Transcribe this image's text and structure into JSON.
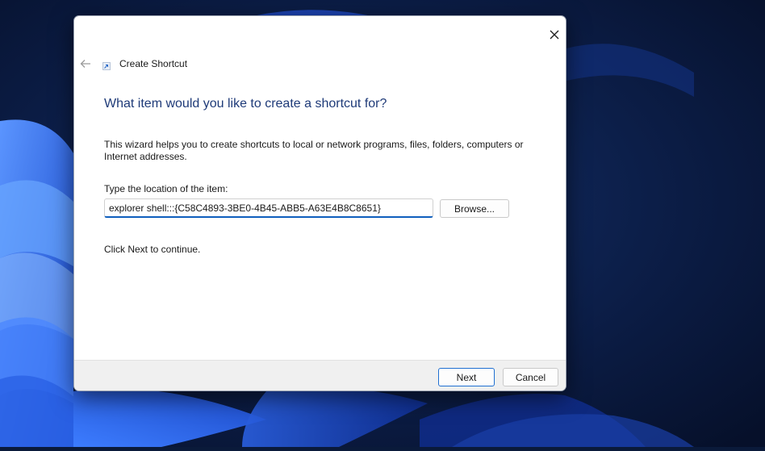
{
  "window": {
    "title": "Create Shortcut"
  },
  "wizard": {
    "heading": "What item would you like to create a shortcut for?",
    "description": "This wizard helps you to create shortcuts to local or network programs, files, folders, computers or Internet addresses.",
    "location_label": "Type the location of the item:",
    "location_value": "explorer shell:::{C58C4893-3BE0-4B45-ABB5-A63E4B8C8651}",
    "browse_label": "Browse...",
    "continue_text": "Click Next to continue."
  },
  "footer": {
    "next_label": "Next",
    "cancel_label": "Cancel"
  },
  "icons": {
    "close": "close-icon",
    "back": "back-arrow-icon",
    "shortcut": "shortcut-icon"
  },
  "colors": {
    "heading": "#1e3a78",
    "input_focus": "#0f5fbd",
    "desktop_background": "#0a1a3a",
    "wallpaper_accent": "#2f6df0"
  }
}
